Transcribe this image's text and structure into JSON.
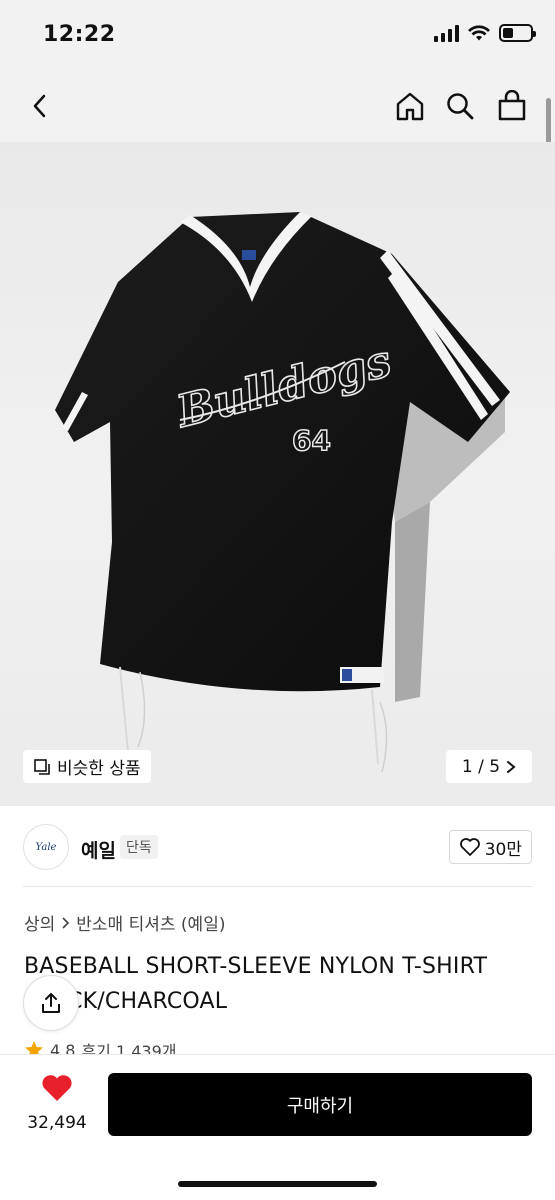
{
  "status_bar": {
    "time": "12:22"
  },
  "nav": {
    "back_icon": "chevron-left-icon",
    "home_icon": "home-icon",
    "search_icon": "search-icon",
    "cart_icon": "shopping-bag-icon"
  },
  "hero": {
    "similar_label": "비슷한 상품",
    "pager": "1 / 5",
    "image_alt": "Black nylon baseball v-neck shirt with Bulldogs 64 script",
    "chest_script": "Bulldogs",
    "chest_number": "64"
  },
  "brand": {
    "logo_text": "Yale",
    "name": "예일",
    "tag": "단독",
    "likes": "30만"
  },
  "product": {
    "breadcrumb": [
      "상의",
      "반소매 티셔츠 (예일)"
    ],
    "title": "BASEBALL SHORT-SLEEVE NYLON T-SHIRT BLACK/CHARCOAL",
    "rating": "4.8",
    "reviews": "후기 1,439개"
  },
  "bottom": {
    "wish_count": "32,494",
    "buy_label": "구매하기"
  },
  "colors": {
    "accent": "#e8202b",
    "star": "#f2a400",
    "button": "#000000"
  }
}
